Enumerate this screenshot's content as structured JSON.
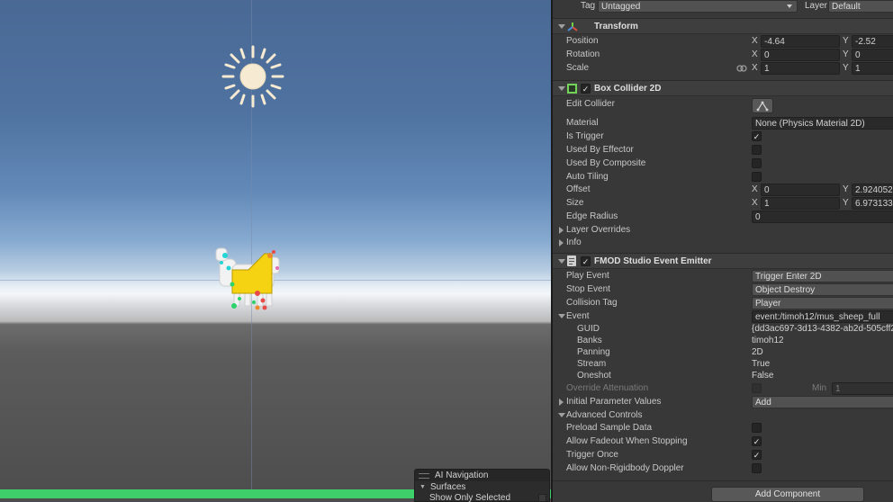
{
  "scene": {
    "overlay": {
      "title": "AI Navigation",
      "section": "Surfaces",
      "row": "Show Only Selected"
    }
  },
  "inspector": {
    "tag_label": "Tag",
    "tag_value": "Untagged",
    "layer_label": "Layer",
    "layer_value": "Default",
    "transform": {
      "title": "Transform",
      "position": {
        "label": "Position",
        "x": "-4.64",
        "y": "-2.52"
      },
      "rotation": {
        "label": "Rotation",
        "x": "0",
        "y": "0"
      },
      "scale": {
        "label": "Scale",
        "x": "1",
        "y": "1"
      }
    },
    "box_collider": {
      "title": "Box Collider 2D",
      "edit_collider": "Edit Collider",
      "material_label": "Material",
      "material_value": "None (Physics Material 2D)",
      "is_trigger": "Is Trigger",
      "used_by_effector": "Used By Effector",
      "used_by_composite": "Used By Composite",
      "auto_tiling": "Auto Tiling",
      "offset": {
        "label": "Offset",
        "x": "0",
        "y": "2.924052"
      },
      "size": {
        "label": "Size",
        "x": "1",
        "y": "6.973133"
      },
      "edge_radius_label": "Edge Radius",
      "edge_radius_value": "0",
      "layer_overrides": "Layer Overrides",
      "info": "Info"
    },
    "fmod": {
      "title": "FMOD Studio Event Emitter",
      "play_event_label": "Play Event",
      "play_event_value": "Trigger Enter 2D",
      "stop_event_label": "Stop Event",
      "stop_event_value": "Object Destroy",
      "collision_tag_label": "Collision Tag",
      "collision_tag_value": "Player",
      "event_label": "Event",
      "event_value": "event:/timoh12/mus_sheep_full",
      "guid_label": "GUID",
      "guid_value": "{dd3ac697-3d13-4382-ab2d-505cff2",
      "banks_label": "Banks",
      "banks_value": "timoh12",
      "panning_label": "Panning",
      "panning_value": "2D",
      "stream_label": "Stream",
      "stream_value": "True",
      "oneshot_label": "Oneshot",
      "oneshot_value": "False",
      "override_attenuation": "Override Attenuation",
      "min_label": "Min",
      "min_value": "1",
      "initial_params": "Initial Parameter Values",
      "add_label": "Add",
      "advanced_controls": "Advanced Controls",
      "preload_sample_data": "Preload Sample Data",
      "allow_fadeout": "Allow Fadeout When Stopping",
      "trigger_once": "Trigger Once",
      "allow_non_rigidbody": "Allow Non-Rigidbody Doppler"
    },
    "axis": {
      "x": "X",
      "y": "Y"
    },
    "checkmark": "✓",
    "add_component": "Add Component"
  },
  "colors": {
    "inspector_bg": "#383838",
    "field_bg": "#2a2a2a",
    "accent_green": "#3fcf6a",
    "sun": "#f6ead2"
  },
  "icons": [
    "transform-icon",
    "box-collider-icon",
    "fmod-component-icon",
    "link-icon",
    "edit-collider-icon",
    "sun-icon"
  ]
}
